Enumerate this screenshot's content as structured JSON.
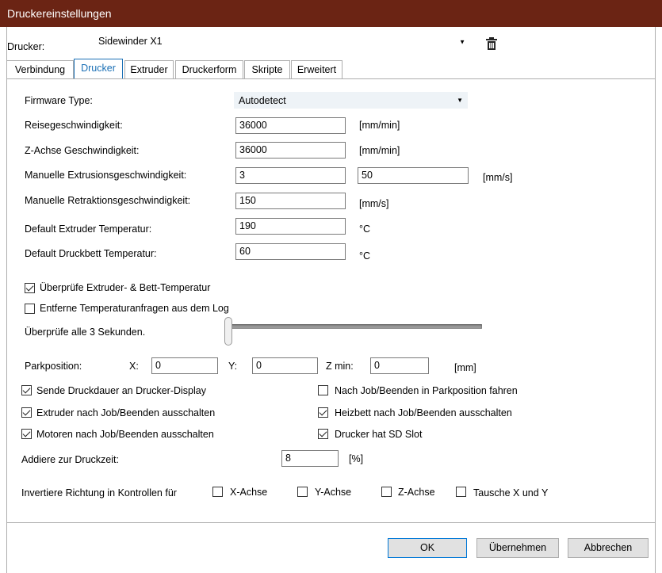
{
  "window": {
    "title": "Druckereinstellungen"
  },
  "printer": {
    "label": "Drucker:",
    "selected": "Sidewinder X1",
    "arrow_icon": "dropdown-arrow-icon",
    "delete_icon": "trash-icon"
  },
  "tabs": [
    "Verbindung",
    "Drucker",
    "Extruder",
    "Druckerform",
    "Skripte",
    "Erweitert"
  ],
  "active_tab": "Drucker",
  "firmware": {
    "label": "Firmware Type:",
    "value": "Autodetect"
  },
  "fields": {
    "travel_speed": {
      "label": "Reisegeschwindigkeit:",
      "value": "36000",
      "unit": "[mm/min]"
    },
    "z_speed": {
      "label": "Z-Achse Geschwindigkeit:",
      "value": "36000",
      "unit": "[mm/min]"
    },
    "manual_extrusion": {
      "label": "Manuelle Extrusionsgeschwindigkeit:",
      "value1": "3",
      "value2": "50",
      "unit": "[mm/s]"
    },
    "manual_retraction": {
      "label": "Manuelle Retraktionsgeschwindigkeit:",
      "value": "150",
      "unit": "[mm/s]"
    },
    "extruder_temp": {
      "label": "Default Extruder Temperatur:",
      "value": "190",
      "unit": "°C"
    },
    "bed_temp": {
      "label": "Default Druckbett Temperatur:",
      "value": "60",
      "unit": "°C"
    }
  },
  "checks": {
    "check_temp": {
      "label": "Überprüfe Extruder- & Bett-Temperatur",
      "checked": true
    },
    "remove_temp_log": {
      "label": "Entferne Temperaturanfragen aus dem Log",
      "checked": false
    }
  },
  "interval": {
    "label": "Überprüfe alle 3 Sekunden.",
    "value": 3
  },
  "park": {
    "label": "Parkposition:",
    "x_label": "X:",
    "x": "0",
    "y_label": "Y:",
    "y": "0",
    "zmin_label": "Z min:",
    "zmin": "0",
    "unit": "[mm]"
  },
  "options": {
    "send_duration": {
      "label": "Sende Druckdauer an Drucker-Display",
      "checked": true
    },
    "park_after": {
      "label": "Nach Job/Beenden in Parkposition fahren",
      "checked": false
    },
    "extruder_off": {
      "label": "Extruder nach Job/Beenden ausschalten",
      "checked": true
    },
    "bed_off": {
      "label": "Heizbett nach Job/Beenden ausschalten",
      "checked": true
    },
    "motors_off": {
      "label": "Motoren nach Job/Beenden ausschalten",
      "checked": true
    },
    "sd_slot": {
      "label": "Drucker hat SD Slot",
      "checked": true
    }
  },
  "print_time": {
    "label": "Addiere zur Druckzeit:",
    "value": "8",
    "unit": "[%]"
  },
  "invert": {
    "label": "Invertiere Richtung in Kontrollen für",
    "x": "X-Achse",
    "y": "Y-Achse",
    "z": "Z-Achse",
    "swap": "Tausche X und Y"
  },
  "buttons": {
    "ok": "OK",
    "apply": "Übernehmen",
    "cancel": "Abbrechen"
  }
}
